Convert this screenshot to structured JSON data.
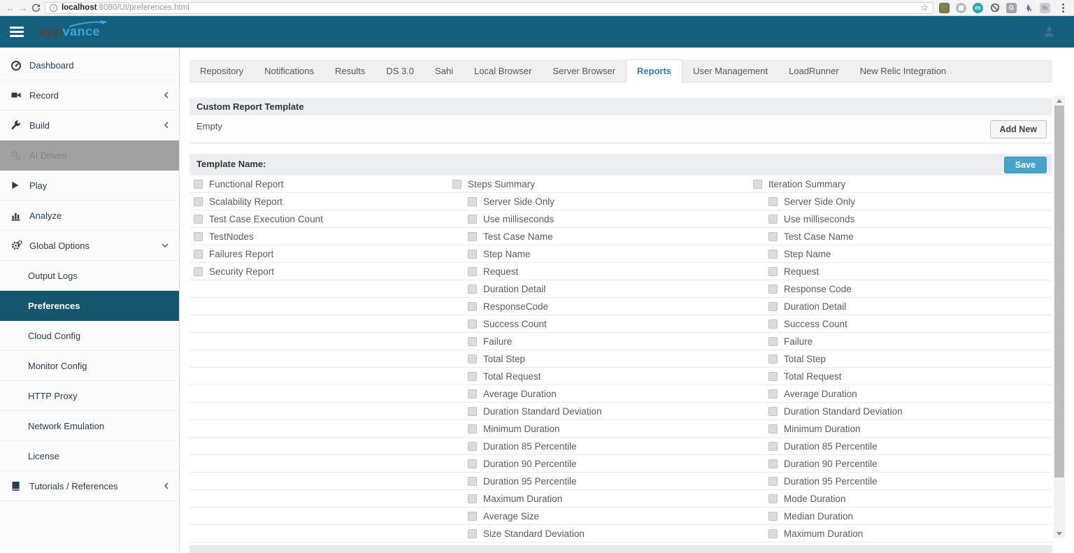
{
  "browser": {
    "url_host": "localhost",
    "url_rest": ":8080/UI/preferences.html",
    "back_icon": "←",
    "forward_icon": "→",
    "extension_icons": [
      "screenshot-ext-icon",
      "circle-ext-icon",
      "m-ext-icon",
      "block-ext-icon",
      "g-ext-icon",
      "pen-ext-icon",
      "fb-ext-icon"
    ],
    "ext_m_letter": "m",
    "ext_g_letter": "G",
    "ext_fb_letters": "fb",
    "bookmark_star": "☆"
  },
  "header": {
    "brand_part1": "app",
    "brand_part2": "vance",
    "background": "#15607c"
  },
  "sidebar": {
    "items": [
      {
        "label": "Dashboard",
        "icon": "dashboard-icon"
      },
      {
        "label": "Record",
        "icon": "video-camera-icon",
        "chevron": "left"
      },
      {
        "label": "Build",
        "icon": "wrench-icon",
        "chevron": "left"
      },
      {
        "label": "AI Driven",
        "icon": "gears-icon",
        "disabled": true
      },
      {
        "label": "Play",
        "icon": "play-icon"
      },
      {
        "label": "Analyze",
        "icon": "bar-chart-icon"
      },
      {
        "label": "Global Options",
        "icon": "gear-icon",
        "chevron": "down"
      }
    ],
    "sub_items": [
      "Output Logs",
      "Preferences",
      "Cloud Config",
      "Monitor Config",
      "HTTP Proxy",
      "Network Emulation",
      "License"
    ],
    "active_sub_item": "Preferences",
    "footer_item": {
      "label": "Tutorials / References",
      "icon": "book-icon",
      "chevron": "left"
    },
    "active_color": "#14576d"
  },
  "tabs": {
    "active": "Reports",
    "items": [
      "Repository",
      "Notifications",
      "Results",
      "DS 3.0",
      "Sahi",
      "Local Browser",
      "Server Browser",
      "Reports",
      "User Management",
      "LoadRunner",
      "New Relic Integration"
    ]
  },
  "panels": {
    "custom_report": {
      "title": "Custom Report Template",
      "empty_label": "Empty",
      "add_new_button": "Add New"
    },
    "template": {
      "title": "Template Name:",
      "save_button": "Save",
      "save_color": "#46a3c9"
    }
  },
  "grid": {
    "all_unchecked": true,
    "rows": [
      [
        {
          "label": "Functional Report",
          "indent": 0
        },
        {
          "label": "Steps Summary",
          "indent": 0
        },
        {
          "label": "Iteration Summary",
          "indent": 0
        }
      ],
      [
        {
          "label": "Scalability Report",
          "indent": 0
        },
        {
          "label": "Server Side Only",
          "indent": 1
        },
        {
          "label": "Server Side Only",
          "indent": 1
        }
      ],
      [
        {
          "label": "Test Case Execution Count",
          "indent": 0
        },
        {
          "label": "Use milliseconds",
          "indent": 1
        },
        {
          "label": "Use milliseconds",
          "indent": 1
        }
      ],
      [
        {
          "label": "TestNodes",
          "indent": 0
        },
        {
          "label": "Test Case Name",
          "indent": 1
        },
        {
          "label": "Test Case Name",
          "indent": 1
        }
      ],
      [
        {
          "label": "Failures Report",
          "indent": 0
        },
        {
          "label": "Step Name",
          "indent": 1
        },
        {
          "label": "Step Name",
          "indent": 1
        }
      ],
      [
        {
          "label": "Security Report",
          "indent": 0
        },
        {
          "label": "Request",
          "indent": 1
        },
        {
          "label": "Request",
          "indent": 1
        }
      ],
      [
        null,
        {
          "label": "Duration Detail",
          "indent": 1
        },
        {
          "label": "Response Code",
          "indent": 1
        }
      ],
      [
        null,
        {
          "label": "ResponseCode",
          "indent": 1
        },
        {
          "label": "Duration Detail",
          "indent": 1
        }
      ],
      [
        null,
        {
          "label": "Success Count",
          "indent": 1
        },
        {
          "label": "Success Count",
          "indent": 1
        }
      ],
      [
        null,
        {
          "label": "Failure",
          "indent": 1
        },
        {
          "label": "Failure",
          "indent": 1
        }
      ],
      [
        null,
        {
          "label": "Total Step",
          "indent": 1
        },
        {
          "label": "Total Step",
          "indent": 1
        }
      ],
      [
        null,
        {
          "label": "Total Request",
          "indent": 1
        },
        {
          "label": "Total Request",
          "indent": 1
        }
      ],
      [
        null,
        {
          "label": "Average Duration",
          "indent": 1
        },
        {
          "label": "Average Duration",
          "indent": 1
        }
      ],
      [
        null,
        {
          "label": "Duration Standard Deviation",
          "indent": 1
        },
        {
          "label": "Duration Standard Deviation",
          "indent": 1
        }
      ],
      [
        null,
        {
          "label": "Minimum Duration",
          "indent": 1
        },
        {
          "label": "Minimum Duration",
          "indent": 1
        }
      ],
      [
        null,
        {
          "label": "Duration 85 Percentile",
          "indent": 1
        },
        {
          "label": "Duration 85 Percentile",
          "indent": 1
        }
      ],
      [
        null,
        {
          "label": "Duration 90 Percentile",
          "indent": 1
        },
        {
          "label": "Duration 90 Percentile",
          "indent": 1
        }
      ],
      [
        null,
        {
          "label": "Duration 95 Percentile",
          "indent": 1
        },
        {
          "label": "Duration 95 Percentile",
          "indent": 1
        }
      ],
      [
        null,
        {
          "label": "Maximum Duration",
          "indent": 1
        },
        {
          "label": "Mode Duration",
          "indent": 1
        }
      ],
      [
        null,
        {
          "label": "Average Size",
          "indent": 1
        },
        {
          "label": "Median Duration",
          "indent": 1
        }
      ],
      [
        null,
        {
          "label": "Size Standard Deviation",
          "indent": 1
        },
        {
          "label": "Maximum Duration",
          "indent": 1
        }
      ]
    ]
  }
}
